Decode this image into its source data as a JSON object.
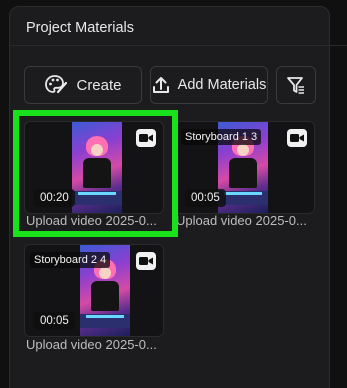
{
  "panel": {
    "title": "Project Materials"
  },
  "toolbar": {
    "create_label": "Create",
    "add_materials_label": "Add Materials",
    "create_icon": "palette-icon",
    "add_icon": "upload-icon",
    "filter_icon": "filter-list-icon"
  },
  "materials": [
    {
      "duration": "00:20",
      "storyboard": "",
      "caption": "Upload video 2025-0...",
      "type_icon": "video-camera-icon",
      "selected": true
    },
    {
      "duration": "00:05",
      "storyboard": "Storyboard 1 3",
      "caption": "Upload video 2025-0...",
      "type_icon": "video-camera-icon",
      "selected": false
    },
    {
      "duration": "00:05",
      "storyboard": "Storyboard 2 4",
      "caption": "Upload video 2025-0...",
      "type_icon": "video-camera-icon",
      "selected": false
    }
  ],
  "colors": {
    "selection": "#19e11b",
    "panel_bg": "#1c1c1e"
  }
}
